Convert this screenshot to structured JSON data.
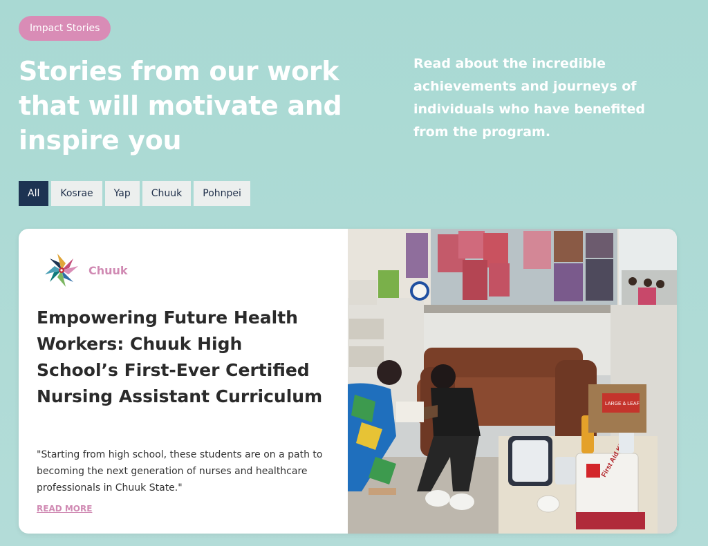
{
  "badge": "Impact Stories",
  "headline": "Stories from our work that will motivate and inspire you",
  "intro": "Read about the incredible achievements and journeys of individuals who have benefited from the program.",
  "filters": [
    {
      "label": "All",
      "active": true
    },
    {
      "label": "Kosrae",
      "active": false
    },
    {
      "label": "Yap",
      "active": false
    },
    {
      "label": "Chuuk",
      "active": false
    },
    {
      "label": "Pohnpei",
      "active": false
    }
  ],
  "card": {
    "region": "Chuuk",
    "title": "Empowering Future Health Workers: Chuuk High School’s First-Ever Certified Nursing Assistant Curriculum",
    "quote": "\"Starting from high school, these students are on a path to becoming the next generation of nurses and healthcare professionals in Chuuk State.\"",
    "read_more": "READ MORE",
    "logo_icon": "pinwheel-logo-icon",
    "photo_kit_label": "First Aid Kit",
    "photo_box_label": "LARGE & LEAF"
  },
  "colors": {
    "accent_pink": "#d98cb6",
    "navy": "#1d3352",
    "background": "#a9d9d3"
  }
}
